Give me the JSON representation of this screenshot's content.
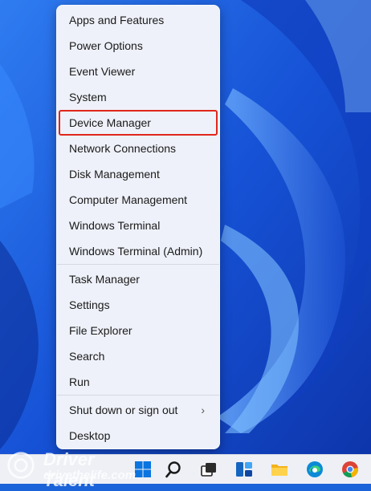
{
  "menu": {
    "items": [
      {
        "label": "Apps and Features"
      },
      {
        "label": "Power Options"
      },
      {
        "label": "Event Viewer"
      },
      {
        "label": "System"
      },
      {
        "label": "Device Manager",
        "highlighted": true
      },
      {
        "label": "Network Connections"
      },
      {
        "label": "Disk Management"
      },
      {
        "label": "Computer Management"
      },
      {
        "label": "Windows Terminal"
      },
      {
        "label": "Windows Terminal (Admin)"
      },
      {
        "label": "Task Manager"
      },
      {
        "label": "Settings"
      },
      {
        "label": "File Explorer"
      },
      {
        "label": "Search"
      },
      {
        "label": "Run"
      },
      {
        "label": "Shut down or sign out",
        "submenu": true
      },
      {
        "label": "Desktop"
      }
    ],
    "highlight_color": "#e0261b"
  },
  "taskbar": {
    "icons": [
      "windows-start-icon",
      "search-icon",
      "task-view-icon",
      "widgets-icon",
      "file-explorer-icon",
      "edge-icon",
      "chrome-icon"
    ]
  },
  "watermark": {
    "brand": "Driver Talent",
    "site": "drivethelife.com"
  }
}
